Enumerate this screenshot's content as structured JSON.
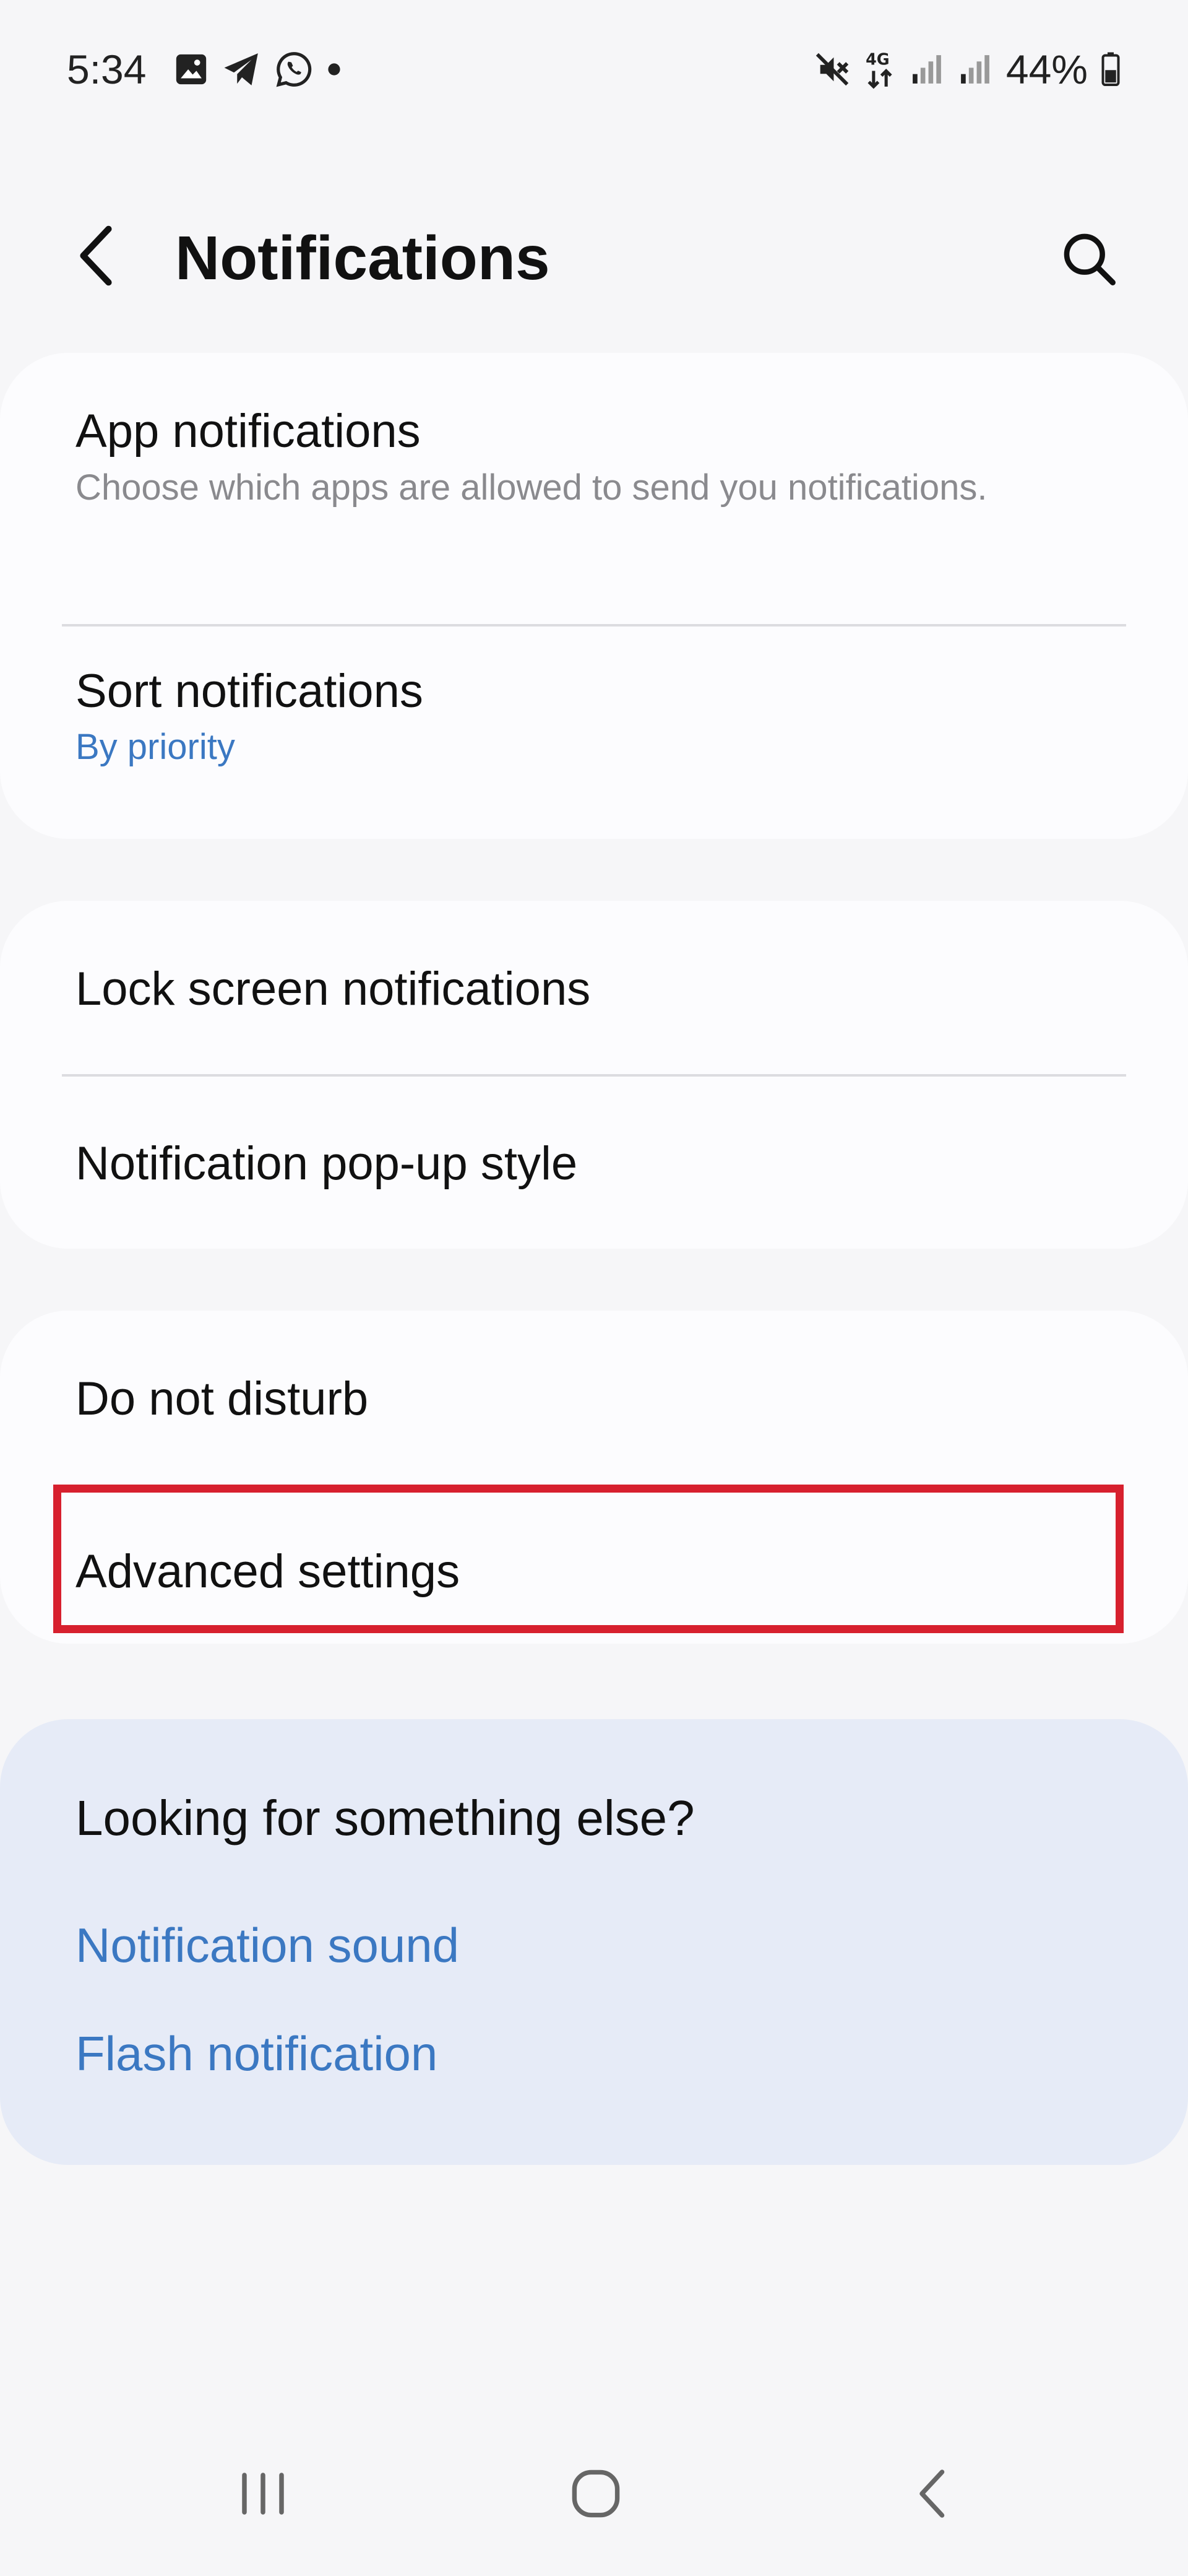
{
  "status_bar": {
    "time": "5:34",
    "battery": "44%",
    "network": "4G",
    "left_icons": [
      "gallery-icon",
      "telegram-icon",
      "whatsapp-icon",
      "dot-icon"
    ],
    "right_icons": [
      "mute-icon",
      "network-4g-icon",
      "signal-icon",
      "signal-icon",
      "battery-icon"
    ]
  },
  "header": {
    "title": "Notifications",
    "back_icon": "chevron-left-icon",
    "search_icon": "search-icon"
  },
  "sections": {
    "group1": {
      "app_notifications": {
        "title": "App notifications",
        "subtitle": "Choose which apps are allowed to send you notifications."
      },
      "sort_notifications": {
        "title": "Sort notifications",
        "value": "By priority"
      }
    },
    "group2": {
      "lock_screen": {
        "title": "Lock screen notifications"
      },
      "popup_style": {
        "title": "Notification pop-up style"
      }
    },
    "group3": {
      "do_not_disturb": {
        "title": "Do not disturb"
      },
      "advanced_settings": {
        "title": "Advanced settings"
      }
    }
  },
  "suggestions": {
    "title": "Looking for something else?",
    "links": [
      "Notification sound",
      "Flash notification"
    ]
  },
  "nav_bar": {
    "icons": [
      "recent-apps-icon",
      "home-icon",
      "back-icon"
    ]
  },
  "colors": {
    "background": "#f6f6f8",
    "card": "#fcfcfe",
    "suggestion_card": "#e6ebf7",
    "accent_blue": "#3b78c2",
    "highlight_red": "#d7202e",
    "subtitle_gray": "#8a8a8e"
  }
}
